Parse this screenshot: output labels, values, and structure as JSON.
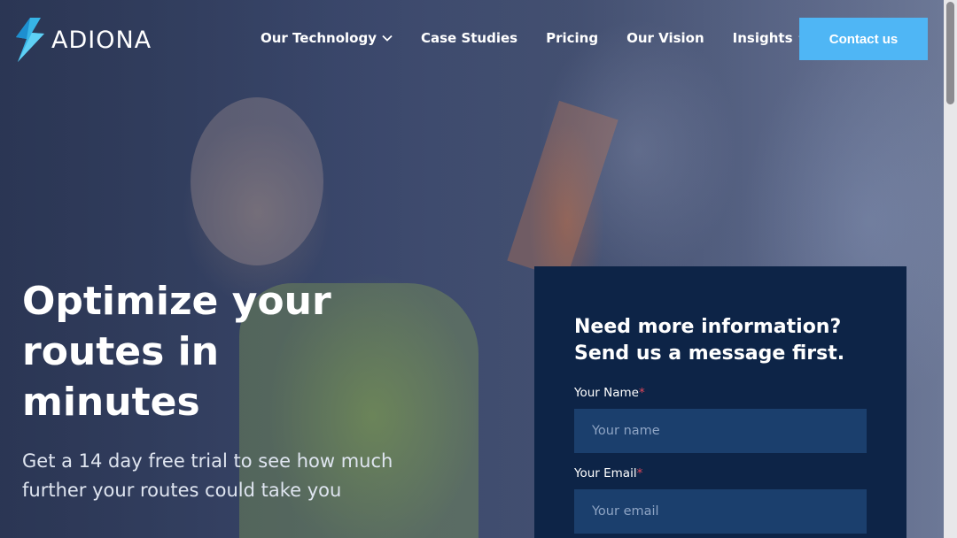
{
  "brand": {
    "name": "ADIONA",
    "accent": "#4fb6f5",
    "panel_bg": "#0d2447"
  },
  "nav": {
    "items": [
      {
        "label": "Our Technology",
        "has_dropdown": true
      },
      {
        "label": "Case Studies",
        "has_dropdown": false
      },
      {
        "label": "Pricing",
        "has_dropdown": false
      },
      {
        "label": "Our Vision",
        "has_dropdown": false
      },
      {
        "label": "Insights",
        "has_dropdown": true
      }
    ],
    "cta_label": "Contact us"
  },
  "hero": {
    "title": "Optimize your routes in minutes",
    "subtitle": "Get a 14 day free trial to see how much further your routes could take you"
  },
  "form": {
    "heading": "Need more information? Send us a message first.",
    "name_label": "Your Name",
    "name_required": "*",
    "name_placeholder": "Your name",
    "email_label": "Your Email",
    "email_required": "*",
    "email_placeholder": "Your email"
  },
  "icons": {
    "logo": "lightning-bolt-logo-icon",
    "dropdown": "chevron-down-icon"
  }
}
